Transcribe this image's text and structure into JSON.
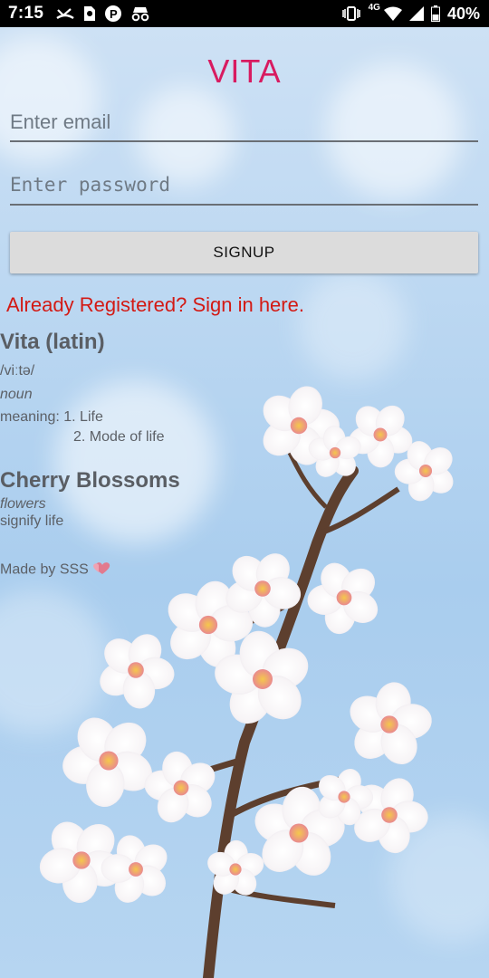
{
  "status_bar": {
    "time": "7:15",
    "network": "4G",
    "battery": "40%",
    "icons": [
      "missed-call-icon",
      "sim-card-icon",
      "parking-icon",
      "incognito-icon",
      "vibrate-icon",
      "wifi-icon",
      "signal-icon",
      "battery-icon"
    ]
  },
  "app": {
    "title": "VITA",
    "title_color": "#d81b60"
  },
  "form": {
    "email_placeholder": "Enter email",
    "password_placeholder": "Enter password",
    "signup_label": "SIGNUP",
    "signin_link": "Already Registered? Sign in here."
  },
  "definition": {
    "word": "Vita (latin)",
    "pronunciation": "/viːtə/",
    "part_of_speech": "noun",
    "meaning_1": "meaning: 1. Life",
    "meaning_2": "2. Mode of life"
  },
  "blossoms": {
    "heading": "Cherry Blossoms",
    "category": "flowers",
    "text": "signify life"
  },
  "credit": {
    "text": "Made by SSS",
    "emoji": "heart-icon"
  }
}
